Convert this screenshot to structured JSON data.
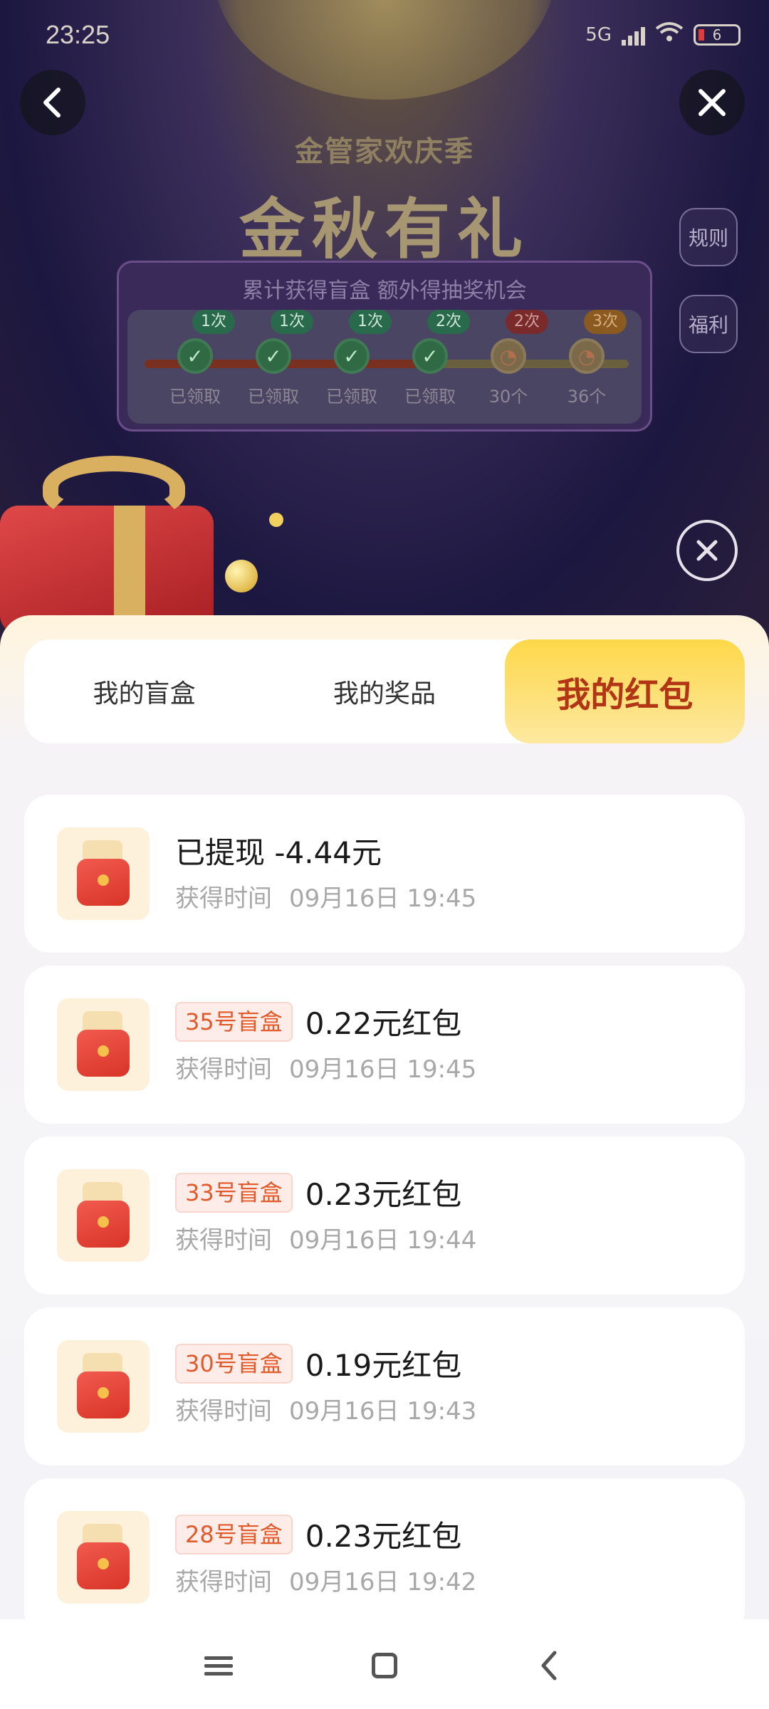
{
  "status_bar": {
    "time": "23:25",
    "network": "5G",
    "battery": "6"
  },
  "header": {
    "subtitle": "金管家欢庆季",
    "title": "金秋有礼",
    "side_buttons": [
      "规则",
      "福利"
    ]
  },
  "progress": {
    "title": "累计获得盲盒 额外得抽奖机会",
    "fill_fraction": 0.62,
    "nodes": [
      {
        "tag": "1次",
        "label": "已领取",
        "done": true
      },
      {
        "tag": "1次",
        "label": "已领取",
        "done": true
      },
      {
        "tag": "1次",
        "label": "已领取",
        "done": true
      },
      {
        "tag": "2次",
        "label": "已领取",
        "done": true
      },
      {
        "tag": "2次",
        "label": "30个",
        "done": false
      },
      {
        "tag": "3次",
        "label": "36个",
        "done": false
      }
    ]
  },
  "tabs": [
    {
      "label": "我的盲盒",
      "active": false
    },
    {
      "label": "我的奖品",
      "active": false
    },
    {
      "label": "我的红包",
      "active": true
    }
  ],
  "records": [
    {
      "badge": "",
      "amount": "已提现 -4.44元",
      "time_label": "获得时间",
      "time": "09月16日 19:45"
    },
    {
      "badge": "35号盲盒",
      "amount": "0.22元红包",
      "time_label": "获得时间",
      "time": "09月16日 19:45"
    },
    {
      "badge": "33号盲盒",
      "amount": "0.23元红包",
      "time_label": "获得时间",
      "time": "09月16日 19:44"
    },
    {
      "badge": "30号盲盒",
      "amount": "0.19元红包",
      "time_label": "获得时间",
      "time": "09月16日 19:43"
    },
    {
      "badge": "28号盲盒",
      "amount": "0.23元红包",
      "time_label": "获得时间",
      "time": "09月16日 19:42"
    }
  ],
  "colors": {
    "accent": "#b23515",
    "badge_text": "#e25a2a",
    "tab_active_bg": "#fdd84a"
  },
  "icons": {
    "back": "chevron-left-icon",
    "close": "close-icon",
    "record": "red-envelope-icon",
    "nav_menu": "menu-icon",
    "nav_home": "home-icon",
    "nav_back": "back-icon"
  }
}
